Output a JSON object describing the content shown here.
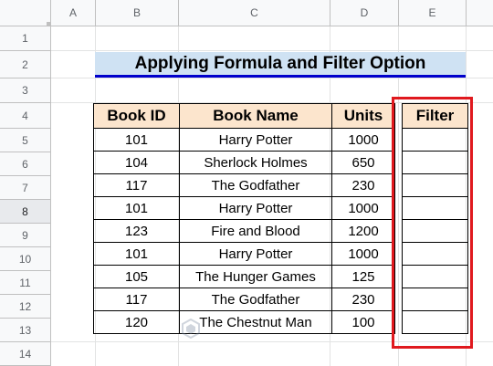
{
  "columns": [
    "A",
    "B",
    "C",
    "D",
    "E"
  ],
  "rows": [
    "1",
    "2",
    "3",
    "4",
    "5",
    "6",
    "7",
    "8",
    "9",
    "10",
    "11",
    "12",
    "13",
    "14"
  ],
  "selected_row": "8",
  "title": "Applying Formula and Filter Option",
  "table": {
    "headers": [
      "Book ID",
      "Book Name",
      "Units",
      "Filter"
    ],
    "rows": [
      [
        "101",
        "Harry Potter",
        "1000",
        ""
      ],
      [
        "104",
        "Sherlock Holmes",
        "650",
        ""
      ],
      [
        "117",
        "The Godfather",
        "230",
        ""
      ],
      [
        "101",
        "Harry Potter",
        "1000",
        ""
      ],
      [
        "123",
        "Fire and Blood",
        "1200",
        ""
      ],
      [
        "101",
        "Harry Potter",
        "1000",
        ""
      ],
      [
        "105",
        "The Hunger Games",
        "125",
        ""
      ],
      [
        "117",
        "The Godfather",
        "230",
        ""
      ],
      [
        "120",
        "The Chestnut Man",
        "100",
        ""
      ]
    ]
  },
  "colors": {
    "title_bg": "#cfe2f3",
    "title_underline": "#0000cc",
    "header_bg": "#fce5cd",
    "highlight_border": "#e0191e"
  },
  "icons": {
    "watermark": "exceldemy-logo-icon"
  }
}
